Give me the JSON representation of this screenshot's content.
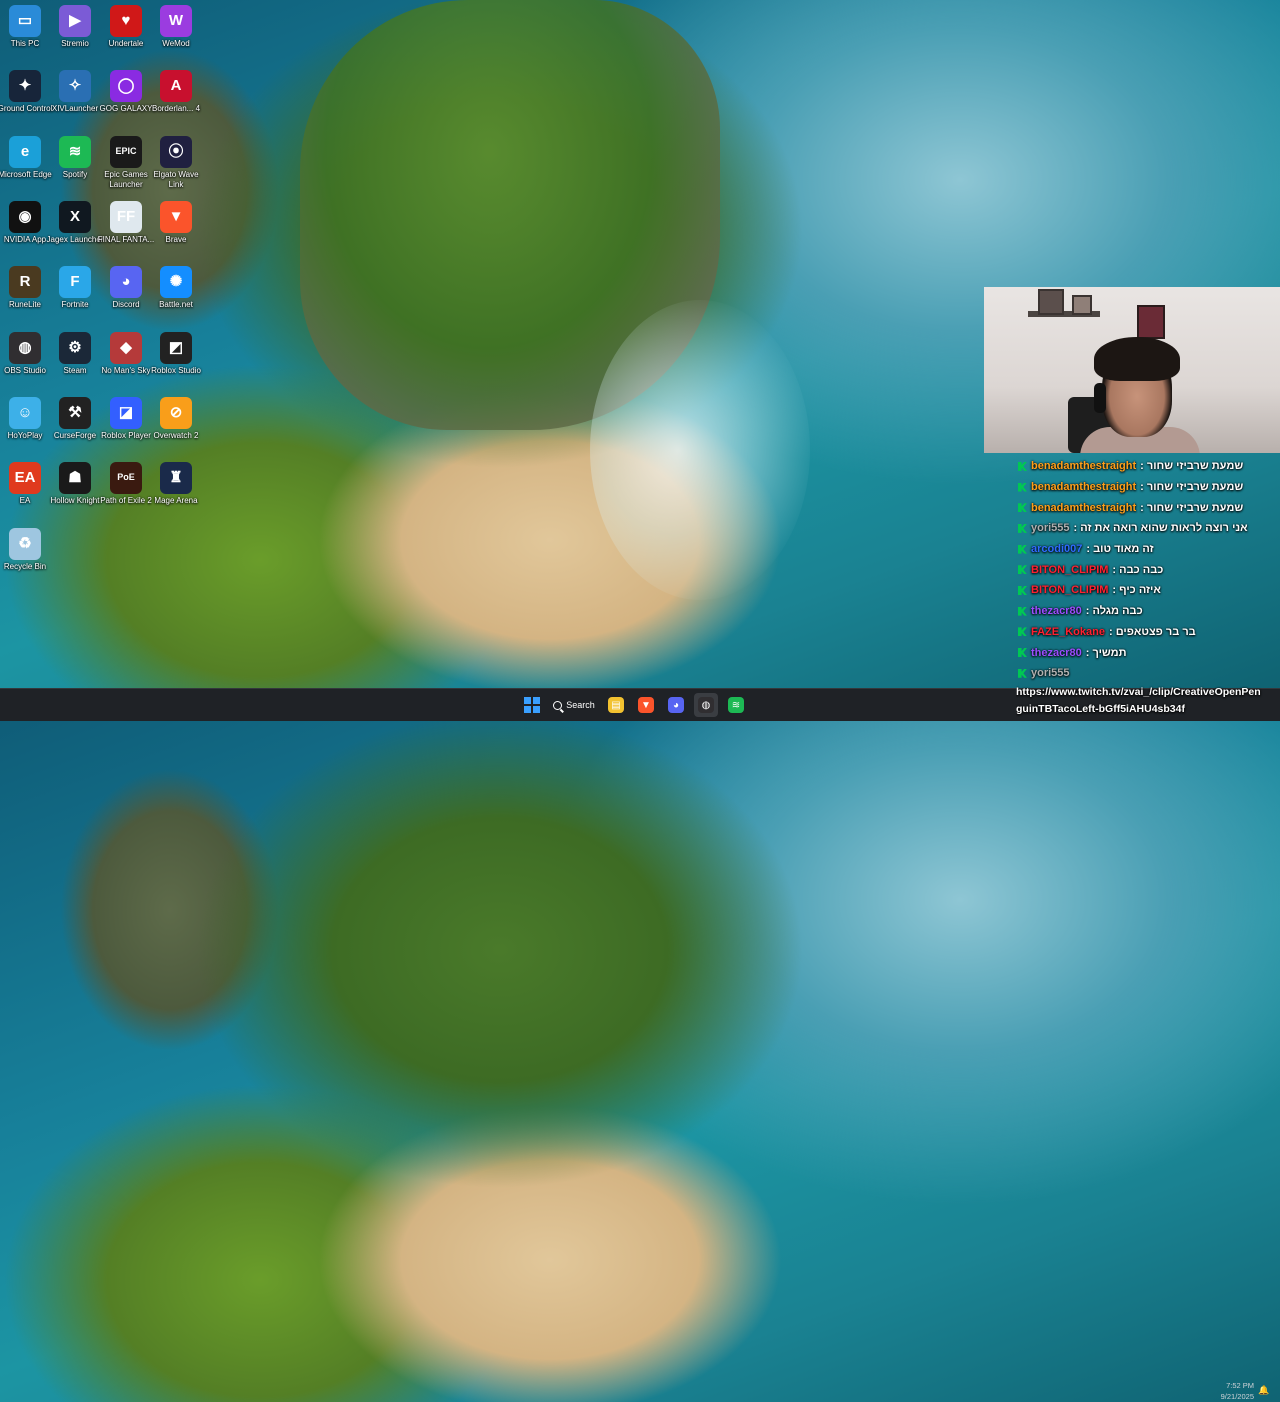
{
  "desktop_icons": [
    {
      "label": "This PC",
      "icon": "monitor-icon",
      "glyph": "▭",
      "color": "#2a8bd8"
    },
    {
      "label": "Stremio",
      "icon": "stremio-icon",
      "glyph": "▶",
      "color": "#7b5bd6"
    },
    {
      "label": "Undertale",
      "icon": "heart-icon",
      "glyph": "♥",
      "color": "#d01818"
    },
    {
      "label": "WeMod",
      "icon": "wemod-icon",
      "glyph": "W",
      "color": "#9b3ce0"
    },
    {
      "label": "Ground Control",
      "icon": "ground-control-icon",
      "glyph": "✦",
      "color": "#17253a"
    },
    {
      "label": "XIVLauncher",
      "icon": "xivlauncher-icon",
      "glyph": "✧",
      "color": "#2a6fb3"
    },
    {
      "label": "GOG GALAXY",
      "icon": "gog-galaxy-icon",
      "glyph": "◯",
      "color": "#8a2be2"
    },
    {
      "label": "Borderlan... 4",
      "icon": "borderlands-icon",
      "glyph": "A",
      "color": "#c8102e"
    },
    {
      "label": "Microsoft Edge",
      "icon": "edge-icon",
      "glyph": "e",
      "color": "#1ba0d8"
    },
    {
      "label": "Spotify",
      "icon": "spotify-icon",
      "glyph": "≋",
      "color": "#1db954"
    },
    {
      "label": "Epic Games Launcher",
      "icon": "epic-games-icon",
      "glyph": "EPIC",
      "color": "#1a1a1a"
    },
    {
      "label": "Elgato Wave Link",
      "icon": "elgato-wave-icon",
      "glyph": "⦿",
      "color": "#202040"
    },
    {
      "label": "NVIDIA App",
      "icon": "nvidia-icon",
      "glyph": "◉",
      "color": "#111"
    },
    {
      "label": "Jagex Launcher",
      "icon": "jagex-icon",
      "glyph": "X",
      "color": "#101820"
    },
    {
      "label": "FINAL FANTA...",
      "icon": "final-fantasy-icon",
      "glyph": "FF",
      "color": "#dfe8ee"
    },
    {
      "label": "Brave",
      "icon": "brave-icon",
      "glyph": "▼",
      "color": "#fb542b"
    },
    {
      "label": "RuneLite",
      "icon": "runelite-icon",
      "glyph": "R",
      "color": "#4a3a20"
    },
    {
      "label": "Fortnite",
      "icon": "fortnite-icon",
      "glyph": "F",
      "color": "#2aa7e8"
    },
    {
      "label": "Discord",
      "icon": "discord-icon",
      "glyph": "◕",
      "color": "#5865f2"
    },
    {
      "label": "Battle.net",
      "icon": "battlenet-icon",
      "glyph": "✺",
      "color": "#148eff"
    },
    {
      "label": "OBS Studio",
      "icon": "obs-icon",
      "glyph": "◍",
      "color": "#302e31"
    },
    {
      "label": "Steam",
      "icon": "steam-icon",
      "glyph": "⚙",
      "color": "#1b2838"
    },
    {
      "label": "No Man's Sky",
      "icon": "no-mans-sky-icon",
      "glyph": "◆",
      "color": "#b53a3a"
    },
    {
      "label": "Roblox Studio",
      "icon": "roblox-studio-icon",
      "glyph": "◩",
      "color": "#222"
    },
    {
      "label": "HoYoPlay",
      "icon": "hoyoplay-icon",
      "glyph": "☺",
      "color": "#3db0e8"
    },
    {
      "label": "CurseForge",
      "icon": "curseforge-icon",
      "glyph": "⚒",
      "color": "#222"
    },
    {
      "label": "Roblox Player",
      "icon": "roblox-player-icon",
      "glyph": "◪",
      "color": "#335fff"
    },
    {
      "label": "Overwatch 2",
      "icon": "overwatch-icon",
      "glyph": "⊘",
      "color": "#f99e1a"
    },
    {
      "label": "EA",
      "icon": "ea-icon",
      "glyph": "EA",
      "color": "#e03a1e"
    },
    {
      "label": "Hollow Knight",
      "icon": "hollow-knight-icon",
      "glyph": "☗",
      "color": "#1a1a1a"
    },
    {
      "label": "Path of Exile 2",
      "icon": "path-of-exile-icon",
      "glyph": "PoE",
      "color": "#3a1a10"
    },
    {
      "label": "Mage Arena",
      "icon": "mage-arena-icon",
      "glyph": "♜",
      "color": "#1a2a4a"
    },
    {
      "label": "Recycle Bin",
      "icon": "recycle-bin-icon",
      "glyph": "♻",
      "color": "#9ec6e0"
    }
  ],
  "chat": [
    {
      "user": "benadamthestraight",
      "color": "#ff9f1a",
      "message": ": שמעת שרביזי שחור"
    },
    {
      "user": "benadamthestraight",
      "color": "#ff9f1a",
      "message": ": שמעת שרביזי שחור"
    },
    {
      "user": "benadamthestraight",
      "color": "#ff9f1a",
      "message": ": שמעת שרביזי שחור"
    },
    {
      "user": "yori555",
      "color": "#b0b0b0",
      "message": ": אני רוצה לראות שהוא רואה את זה"
    },
    {
      "user": "arcodi007",
      "color": "#2e6bff",
      "message": ": זה מאוד טוב"
    },
    {
      "user": "BITON_CLIPIM",
      "color": "#ff2030",
      "message": ": כבה כבה"
    },
    {
      "user": "BITON_CLIPIM",
      "color": "#ff2030",
      "message": ": איזה כיף"
    },
    {
      "user": "thezacr80",
      "color": "#9b4dff",
      "message": ": כבה מגלה"
    },
    {
      "user": "FAZE_Kokane",
      "color": "#ff2030",
      "message": ": בר בר פצטאפים"
    },
    {
      "user": "thezacr80",
      "color": "#9b4dff",
      "message": ": תמשיך"
    },
    {
      "user": "yori555",
      "color": "#b0b0b0",
      "message": ""
    }
  ],
  "taskbar": {
    "search_label": "Search",
    "apps": [
      {
        "name": "file-explorer-icon",
        "glyph": "▤",
        "color": "#f2c230"
      },
      {
        "name": "brave-taskbar-icon",
        "glyph": "▼",
        "color": "#fb542b"
      },
      {
        "name": "discord-taskbar-icon",
        "glyph": "◕",
        "color": "#5865f2"
      },
      {
        "name": "obs-taskbar-icon",
        "glyph": "◍",
        "color": "#302e31"
      },
      {
        "name": "spotify-taskbar-icon",
        "glyph": "≋",
        "color": "#1db954"
      }
    ],
    "time": "7:52 PM",
    "date": "9/21/2025"
  },
  "clip_url": {
    "line1": "https://www.twitch.tv/zvai_/clip/CreativeOpenPen",
    "line2": "guinTBTacoLeft-bGff5iAHU4sb34f"
  }
}
